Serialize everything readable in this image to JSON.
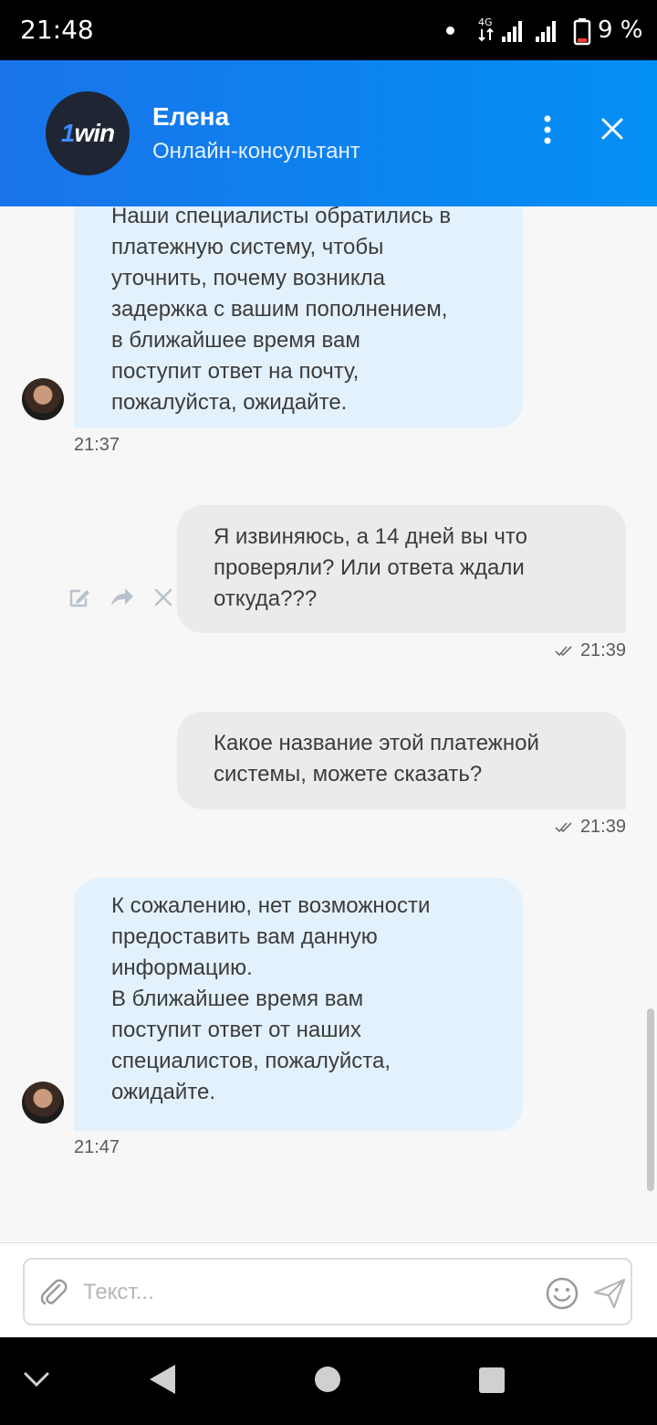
{
  "status_bar": {
    "time": "21:48",
    "network": "4G",
    "battery": "9 %"
  },
  "header": {
    "logo": "1win",
    "agent_name": "Елена",
    "agent_role": "Онлайн-консультант",
    "menu_icon": "more-vert-icon",
    "close_icon": "close-icon"
  },
  "messages": [
    {
      "direction": "incoming",
      "lines": [
        "Наши специалисты обратились в",
        "платежную систему, чтобы",
        "уточнить, почему возникла",
        "задержка с вашим пополнением,",
        "в ближайшее время вам",
        "поступит ответ на почту,",
        "пожалуйста, ожидайте."
      ],
      "time": "21:37"
    },
    {
      "direction": "outgoing",
      "lines": [
        "Я извиняюсь, а 14 дней вы что",
        "проверяли? Или ответа ждали",
        "откуда???"
      ],
      "time": "21:39",
      "status": "read"
    },
    {
      "direction": "outgoing",
      "lines": [
        "Какое название этой платежной",
        "системы, можете сказать?"
      ],
      "time": "21:39",
      "status": "read"
    },
    {
      "direction": "incoming",
      "lines": [
        "К сожалению, нет возможности",
        "предоставить вам данную",
        "информацию.",
        "В ближайшее время вам",
        "поступит ответ от наших",
        "специалистов, пожалуйста,",
        "ожидайте."
      ],
      "time": "21:47"
    }
  ],
  "composer": {
    "placeholder": "Текст...",
    "value": "",
    "attach_icon": "paperclip-icon",
    "emoji_icon": "smile-icon",
    "send_icon": "send-icon"
  },
  "colors": {
    "header_gradient_start": "#1a74ea",
    "header_gradient_end": "#0590f5",
    "incoming_bubble": "#e3f1fd",
    "outgoing_bubble": "#ebebeb",
    "chat_background": "#f7f7f7"
  }
}
